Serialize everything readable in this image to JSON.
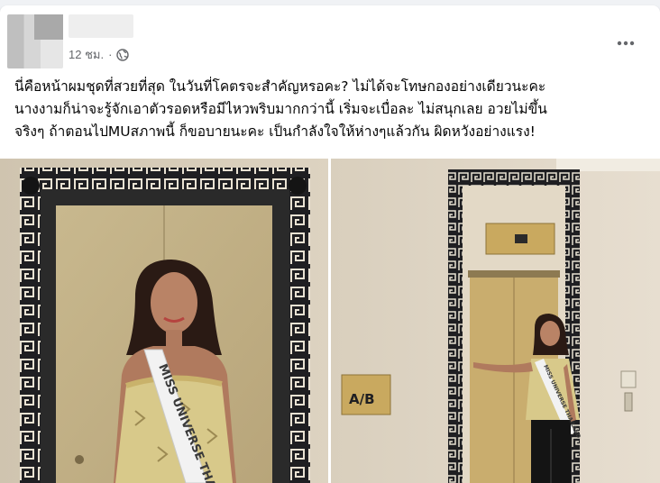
{
  "post": {
    "timestamp": "12 ชม.",
    "separator": "·",
    "privacy_icon": "globe-icon",
    "more_icon": "more-options-icon",
    "caption_lines": [
      "นี่คือหน้าผมชุดที่สวยที่สุด ในวันที่โคตรจะสำคัญหรอคะ? ไม่ได้จะโทษกองอย่างเดียวนะคะ",
      "นางงามก็น่าจะรู้จักเอาตัวรอดหรือมีไหวพริบมากกว่านี้ เริ่มจะเบื่อละ ไม่สนุกเลย อวยไม่ขึ้น",
      "จริงๆ ถ้าตอนไปMUสภาพนี้ ก็ขอบายนะคะ เป็นกำลังใจให้ห่างๆแล้วกัน ผิดหวังอย่างแรง!"
    ]
  },
  "photos": {
    "left": {
      "sash_text": "MISS UNIVERSE THAIL"
    },
    "right": {
      "floor_sign": "A/B",
      "sash_text": "MISS UNIVERSE THAILAND"
    }
  },
  "colors": {
    "text": "#050505",
    "meta": "#65676b",
    "frame_dark": "#1f1f22",
    "door_gold": "#c9ad6e",
    "dress_yellow": "#d8c98a"
  }
}
